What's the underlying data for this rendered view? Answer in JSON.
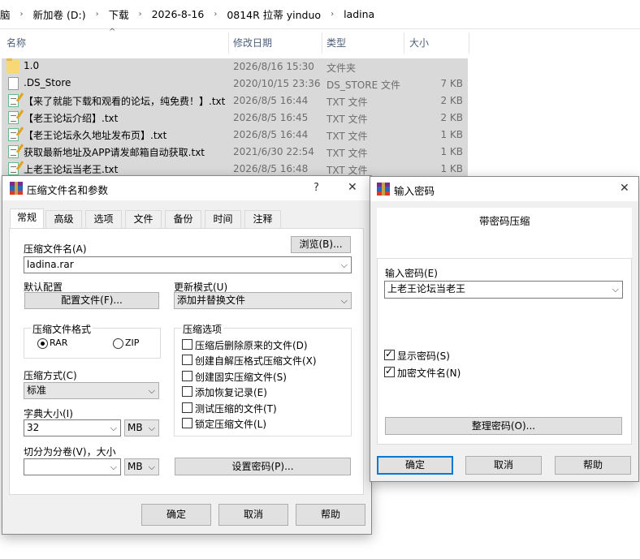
{
  "explorer": {
    "breadcrumb": [
      "脑",
      "新加卷 (D:)",
      "下载",
      "2026-8-16",
      "0814R 拉蒂 yinduo",
      "ladina"
    ],
    "columns": {
      "name": "名称",
      "modified": "修改日期",
      "type": "类型",
      "size": "大小"
    },
    "files": [
      {
        "name": "1.0",
        "modified": "2026/8/16 15:30",
        "type": "文件夹",
        "size": "",
        "icon": "folder-icon"
      },
      {
        "name": ".DS_Store",
        "modified": "2020/10/15 23:36",
        "type": "DS_STORE 文件",
        "size": "7 KB",
        "icon": "file-icon"
      },
      {
        "name": "【来了就能下载和观看的论坛，纯免费！】.txt",
        "modified": "2026/8/5 16:44",
        "type": "TXT 文件",
        "size": "2 KB",
        "icon": "text-file-icon"
      },
      {
        "name": "【老王论坛介绍】.txt",
        "modified": "2026/8/5 16:45",
        "type": "TXT 文件",
        "size": "2 KB",
        "icon": "text-file-icon"
      },
      {
        "name": "【老王论坛永久地址发布页】.txt",
        "modified": "2026/8/5 16:44",
        "type": "TXT 文件",
        "size": "1 KB",
        "icon": "text-file-icon"
      },
      {
        "name": "获取最新地址及APP请发邮箱自动获取.txt",
        "modified": "2021/6/30 22:54",
        "type": "TXT 文件",
        "size": "1 KB",
        "icon": "text-file-icon"
      },
      {
        "name": "上老王论坛当老王.txt",
        "modified": "2026/8/5 16:48",
        "type": "TXT 文件",
        "size": "1 KB",
        "icon": "text-file-icon"
      }
    ]
  },
  "compress_dialog": {
    "title": "压缩文件名和参数",
    "help_glyph": "?",
    "close_glyph": "✕",
    "tabs": [
      "常规",
      "高级",
      "选项",
      "文件",
      "备份",
      "时间",
      "注释"
    ],
    "archive_name_label": "压缩文件名(A)",
    "browse_label": "浏览(B)...",
    "archive_name_value": "ladina.rar",
    "default_profile_label": "默认配置",
    "profiles_button": "配置文件(F)...",
    "update_mode_label": "更新模式(U)",
    "update_mode_value": "添加并替换文件",
    "format_group": "压缩文件格式",
    "format_rar": "RAR",
    "format_zip": "ZIP",
    "options_group": "压缩选项",
    "options": [
      {
        "label": "压缩后删除原来的文件(D)",
        "checked": false
      },
      {
        "label": "创建自解压格式压缩文件(X)",
        "checked": false
      },
      {
        "label": "创建固实压缩文件(S)",
        "checked": false
      },
      {
        "label": "添加恢复记录(E)",
        "checked": false
      },
      {
        "label": "测试压缩的文件(T)",
        "checked": false
      },
      {
        "label": "锁定压缩文件(L)",
        "checked": false
      }
    ],
    "method_label": "压缩方式(C)",
    "method_value": "标准",
    "dict_label": "字典大小(I)",
    "dict_value": "32",
    "dict_unit": "MB",
    "split_label": "切分为分卷(V)，大小",
    "split_value": "",
    "split_unit": "MB",
    "set_password_button": "设置密码(P)...",
    "ok": "确定",
    "cancel": "取消",
    "help": "帮助"
  },
  "password_dialog": {
    "title": "输入密码",
    "close_glyph": "✕",
    "heading": "带密码压缩",
    "password_label": "输入密码(E)",
    "password_value": "上老王论坛当老王",
    "show_password": "显示密码(S)",
    "show_password_checked": true,
    "encrypt_names": "加密文件名(N)",
    "encrypt_names_checked": true,
    "organize_button": "整理密码(O)...",
    "ok": "确定",
    "cancel": "取消",
    "help": "帮助"
  }
}
